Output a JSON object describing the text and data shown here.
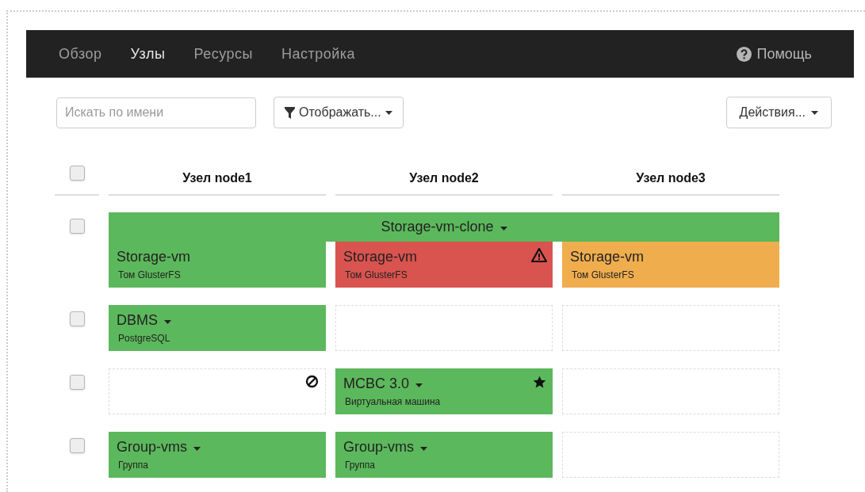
{
  "navbar": {
    "items": [
      {
        "label": "Обзор",
        "selected": false
      },
      {
        "label": "Узлы",
        "selected": true
      },
      {
        "label": "Ресурсы",
        "selected": false
      },
      {
        "label": "Настройка",
        "selected": false
      }
    ],
    "help": "Помощь"
  },
  "toolbar": {
    "search": {
      "placeholder": "Искать по имени"
    },
    "filter_button": "Отображать...",
    "actions_button": "Действия..."
  },
  "table": {
    "header_checked": false,
    "columns": [
      "Узел node1",
      "Узел node2",
      "Узел node3"
    ],
    "rows": [
      {
        "checked": false,
        "group": {
          "name": "Storage-vm-clone",
          "menu": true,
          "color": "#5cb85c"
        },
        "cells": [
          {
            "kind": "resource",
            "name": "Storage-vm",
            "subtitle": "Том GlusterFS",
            "menu": false,
            "color": "#5cb85c"
          },
          {
            "kind": "resource",
            "name": "Storage-vm",
            "subtitle": "Том GlusterFS",
            "menu": false,
            "color": "#d9534f",
            "warning": true
          },
          {
            "kind": "resource",
            "name": "Storage-vm",
            "subtitle": "Том GlusterFS",
            "menu": false,
            "color": "#f0ad4e"
          }
        ]
      },
      {
        "checked": false,
        "cells": [
          {
            "kind": "resource",
            "name": "DBMS",
            "subtitle": "PostgreSQL",
            "menu": true,
            "color": "#5cb85c"
          },
          {
            "kind": "empty"
          },
          {
            "kind": "empty"
          }
        ]
      },
      {
        "checked": false,
        "cells": [
          {
            "kind": "empty",
            "blocked": true
          },
          {
            "kind": "resource",
            "name": "MCBC 3.0",
            "subtitle": "Виртуальная машина",
            "menu": true,
            "color": "#5cb85c",
            "starred": true
          },
          {
            "kind": "empty"
          }
        ]
      },
      {
        "checked": false,
        "cells": [
          {
            "kind": "resource",
            "name": "Group-vms",
            "subtitle": "Группа",
            "menu": true,
            "color": "#5cb85c"
          },
          {
            "kind": "resource",
            "name": "Group-vms",
            "subtitle": "Группа",
            "menu": true,
            "color": "#5cb85c"
          },
          {
            "kind": "empty"
          }
        ]
      }
    ]
  }
}
